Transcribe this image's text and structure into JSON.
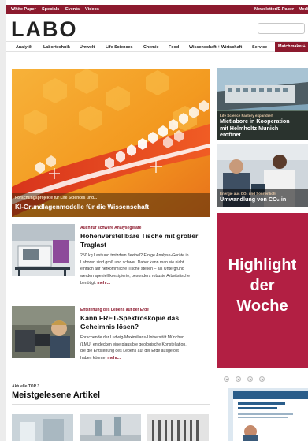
{
  "topbar": {
    "links": [
      "White Paper",
      "Specials",
      "Events",
      "Videos"
    ],
    "right_links": [
      "Newsletter/E-Paper",
      "Mediadaten"
    ]
  },
  "header": {
    "logo": "LABO",
    "search_placeholder": ""
  },
  "nav": {
    "items": [
      "Analytik",
      "Labortechnik",
      "Umwelt",
      "Life Sciences",
      "Chemie",
      "Food",
      "Wissenschaft + Wirtschaft",
      "Service"
    ],
    "highlight": "Matchmaker+"
  },
  "hero": {
    "kicker": "Forschungsprojekte für Life Sciences und...",
    "title": "KI-Grundlagenmodelle für die Wissenschaft"
  },
  "side": [
    {
      "kicker": "Life Science Factory expandiert",
      "title_lines": [
        "Mietlabore in Kooperation",
        "mit Helmholtz Munich",
        "eröffnet"
      ]
    },
    {
      "kicker": "Energie aus CO₂ und Sonnenlicht",
      "title_lines": [
        "Umwandlung von CO₂ in"
      ]
    }
  ],
  "articles": [
    {
      "kicker": "Auch für schwere Analysegeräte",
      "title_lines": [
        "Höhenverstellbare Tische mit großer",
        "Traglast"
      ],
      "text_lines": [
        "250 kg Last und trotzdem flexibel? Einige Analyse-Geräte in",
        "Laboren sind groß und schwer. Daher kann man sie nicht",
        "einfach auf herkömmliche Tische stellen – als Untergrund",
        "werden speziell konzipierte, besonders robuste Arbeitstische",
        "benötigt."
      ],
      "more": "mehr..."
    },
    {
      "kicker": "Entstehung des Lebens auf der Erde",
      "title_lines": [
        "Kann FRET-Spektroskopie das",
        "Geheimnis lösen?"
      ],
      "text_lines": [
        "Forschende der Ludwig-Maximilians-Universität München",
        "(LMU) entdecken eine plausible geologische Konstellation,",
        "die die Entstehung des Lebens auf der Erde ausgelöst",
        "haben könnte."
      ],
      "more": "mehr..."
    }
  ],
  "highlight_box": {
    "lines": [
      "Highlight",
      "der",
      "Woche"
    ]
  },
  "top3": {
    "kicker": "Aktuelle TOP 3",
    "title": "Meistgelesene Artikel"
  },
  "colors": {
    "brand": "#8c1a2e",
    "highlight": "#b21f43"
  }
}
